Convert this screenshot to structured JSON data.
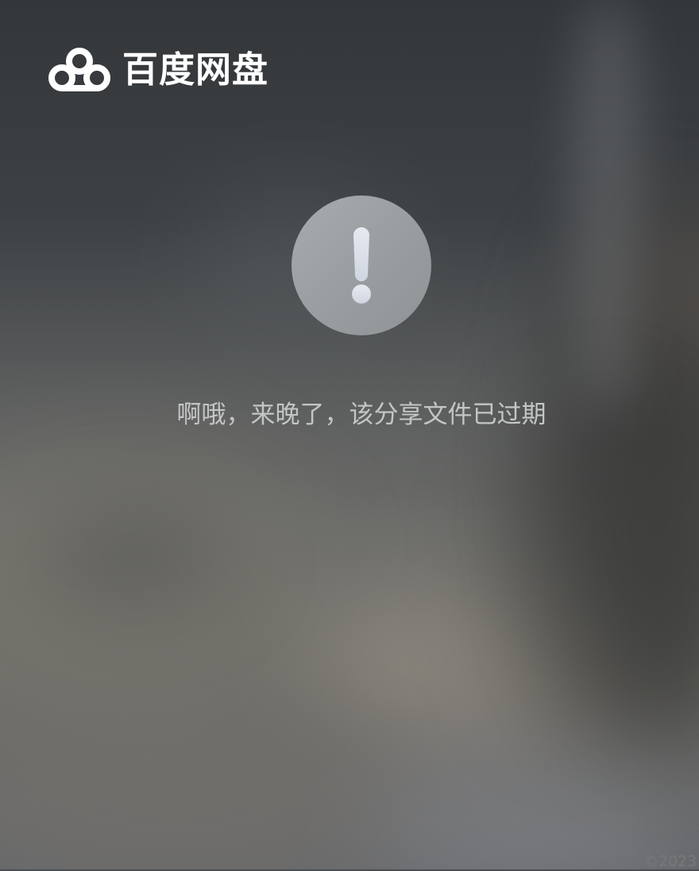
{
  "brand": {
    "name": "百度网盘",
    "logo_icon": "baidu-cloud-icon"
  },
  "status": {
    "icon": "exclamation-icon",
    "message": "啊哦，来晚了，该分享文件已过期"
  },
  "footer": {
    "copyright": "©2023"
  },
  "colors": {
    "text_primary": "#ffffff",
    "message_text": "#c4c5c6",
    "alert_circle": "#9ea2a5",
    "alert_mark": "#d8dde5"
  }
}
